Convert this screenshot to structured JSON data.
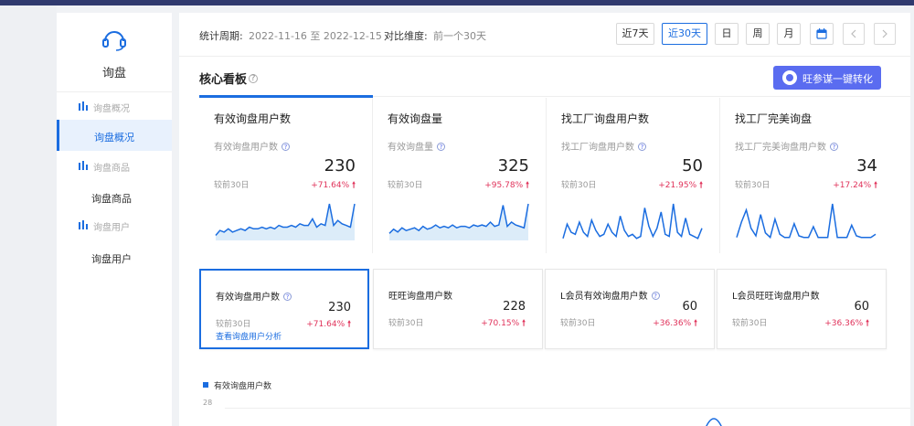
{
  "colors": {
    "accent": "#1b6de0",
    "cta": "#5a6cf0",
    "increase": "#e0325a",
    "chart_fill": "#dcecf9"
  },
  "sidebar": {
    "icon": "headset-icon",
    "title": "询盘",
    "groups": [
      {
        "label": "询盘概况",
        "icon": "chart-icon",
        "item": "询盘概况"
      },
      {
        "label": "询盘商品",
        "icon": "chart-icon",
        "item": "询盘商品"
      },
      {
        "label": "询盘用户",
        "icon": "chart-icon",
        "item": "询盘用户"
      }
    ]
  },
  "filter": {
    "period_label": "统计周期:",
    "period_value": "2022-11-16 至 2022-12-15",
    "compare_label": "对比维度:",
    "compare_value": "前一个30天",
    "buttons": [
      "近7天",
      "近30天",
      "日",
      "周",
      "月"
    ],
    "icons": [
      "calendar-icon",
      "prev-icon",
      "next-icon"
    ]
  },
  "board": {
    "title": "核心看板",
    "help": "?",
    "cta": "旺参谋一键转化"
  },
  "metrics": [
    {
      "title": "有效询盘用户数",
      "subtitle": "有效询盘用户数",
      "value": "230",
      "compare": "较前30日",
      "delta": "+71.64%"
    },
    {
      "title": "有效询盘量",
      "subtitle": "有效询盘量",
      "value": "325",
      "compare": "较前30日",
      "delta": "+95.78%"
    },
    {
      "title": "找工厂询盘用户数",
      "subtitle": "找工厂询盘用户数",
      "value": "50",
      "compare": "较前30日",
      "delta": "+21.95%"
    },
    {
      "title": "找工厂完美询盘",
      "subtitle": "找工厂完美询盘用户数",
      "value": "34",
      "compare": "较前30日",
      "delta": "+17.24%"
    }
  ],
  "cards": [
    {
      "title": "有效询盘用户数",
      "value": "230",
      "compare": "较前30日",
      "delta": "+71.64%",
      "link": "查看询盘用户分析"
    },
    {
      "title": "旺旺询盘用户数",
      "value": "228",
      "compare": "较前30日",
      "delta": "+70.15%"
    },
    {
      "title": "L会员有效询盘用户数",
      "value": "60",
      "compare": "较前30日",
      "delta": "+36.36%"
    },
    {
      "title": "L会员旺旺询盘用户数",
      "value": "60",
      "compare": "较前30日",
      "delta": "+36.36%"
    }
  ],
  "trend": {
    "legend": "有效询盘用户数",
    "ytick": "28"
  },
  "chart_data": [
    {
      "type": "area",
      "values": [
        3,
        6,
        5,
        7,
        5,
        6,
        7,
        6,
        8,
        7,
        7,
        8,
        7,
        8,
        7,
        9,
        8,
        8,
        9,
        8,
        10,
        9,
        9,
        13,
        8,
        10,
        9,
        22,
        9,
        12,
        10,
        9,
        8,
        22
      ]
    },
    {
      "type": "area",
      "values": [
        5,
        8,
        6,
        9,
        7,
        8,
        9,
        7,
        10,
        8,
        9,
        11,
        9,
        10,
        9,
        11,
        9,
        10,
        10,
        9,
        11,
        10,
        11,
        10,
        13,
        10,
        11,
        25,
        10,
        13,
        11,
        10,
        9,
        26
      ]
    },
    {
      "type": "line",
      "values": [
        1,
        8,
        4,
        3,
        9,
        4,
        2,
        10,
        5,
        2,
        3,
        8,
        4,
        2,
        12,
        5,
        2,
        3,
        1,
        2,
        16,
        7,
        2,
        6,
        14,
        3,
        2,
        18,
        4,
        2,
        11,
        3,
        2,
        1,
        6
      ]
    },
    {
      "type": "line",
      "values": [
        2,
        12,
        20,
        8,
        3,
        17,
        5,
        2,
        14,
        4,
        2,
        2,
        11,
        3,
        2,
        2,
        9,
        2,
        2,
        2,
        24,
        2,
        2,
        2,
        10,
        3,
        2,
        2,
        2,
        4
      ]
    }
  ]
}
